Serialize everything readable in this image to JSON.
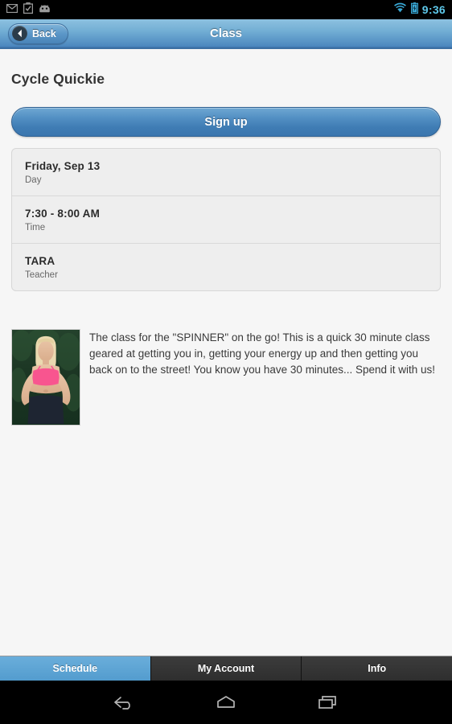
{
  "statusbar": {
    "notification_icons": [
      "email-icon",
      "clipboard-check-icon",
      "android-face-icon"
    ],
    "wifi_icon": "wifi-icon",
    "battery_icon": "battery-charging-icon",
    "clock": "9:36",
    "clock_color": "#5ec8ea"
  },
  "titlebar": {
    "back_label": "Back",
    "back_icon": "chevron-left-icon",
    "title": "Class",
    "accent_color": "#5b97c8"
  },
  "main": {
    "page_title": "Cycle Quickie",
    "signup_label": "Sign up",
    "info_rows": [
      {
        "value": "Friday, Sep 13",
        "label": "Day"
      },
      {
        "value": "7:30 - 8:00 AM",
        "label": "Time"
      },
      {
        "value": "TARA",
        "label": "Teacher"
      }
    ],
    "description": "The class for the \"SPINNER\" on the go! This is a quick 30 minute class geared at getting you in, getting your energy up and then getting you back on to the street! You know you have 30 minutes... Spend it with us!",
    "thumbnail_alt": "instructor-photo"
  },
  "tabbar": {
    "tabs": [
      {
        "label": "Schedule",
        "active": true
      },
      {
        "label": "My Account",
        "active": false
      },
      {
        "label": "Info",
        "active": false
      }
    ],
    "active_color": "#539cce"
  },
  "navbar": {
    "buttons": [
      "back-nav-icon",
      "home-nav-icon",
      "recents-nav-icon"
    ]
  }
}
